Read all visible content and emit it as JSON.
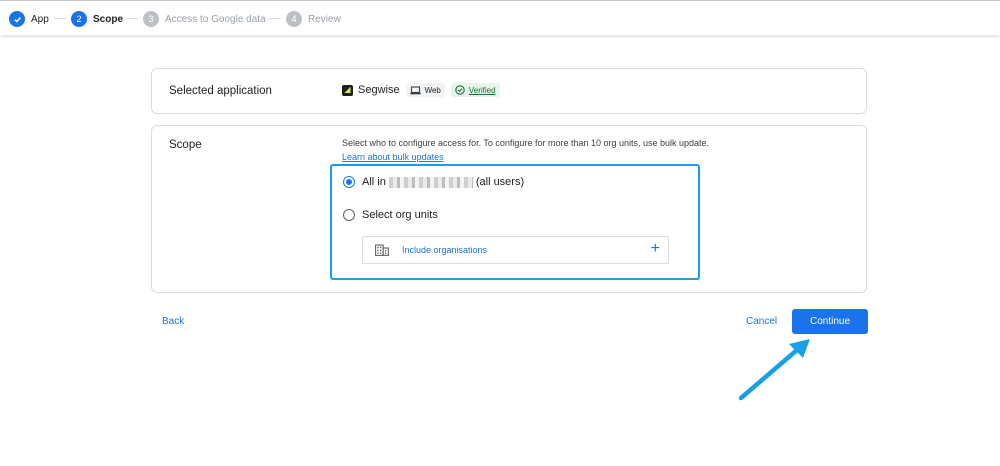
{
  "stepper": {
    "steps": [
      {
        "number": "✓",
        "label": "App"
      },
      {
        "number": "2",
        "label": "Scope"
      },
      {
        "number": "3",
        "label": "Access to Google data"
      },
      {
        "number": "4",
        "label": "Review"
      }
    ]
  },
  "selected_app": {
    "title": "Selected application",
    "app_name": "Segwise",
    "platform_chip": "Web",
    "verified_chip": "Verified"
  },
  "scope": {
    "title": "Scope",
    "description": "Select who to configure access for. To configure for more than 10 org units, use bulk update.",
    "learn_link": "Learn about bulk updates",
    "option_all_prefix": "All in",
    "option_all_suffix": "(all users)",
    "option_select": "Select org units",
    "include_orgs": "Include organisations"
  },
  "actions": {
    "back": "Back",
    "cancel": "Cancel",
    "continue": "Continue"
  },
  "colors": {
    "accent": "#1a73e8",
    "highlight": "#18a0e6",
    "verified": "#137333"
  },
  "icons": [
    "check-icon",
    "laptop-icon",
    "verified-check-icon",
    "building-icon",
    "plus-icon",
    "annotation-arrow"
  ]
}
